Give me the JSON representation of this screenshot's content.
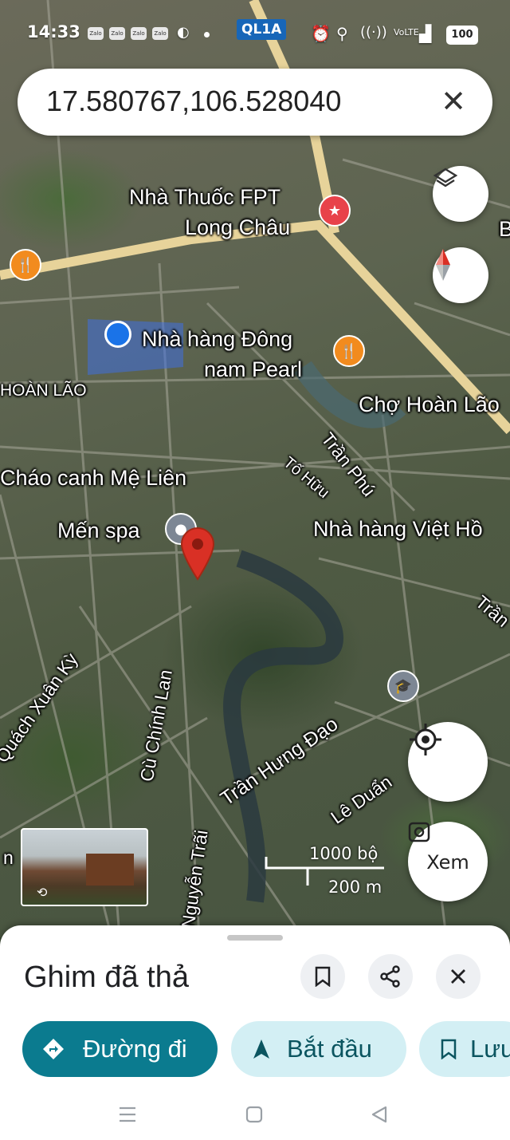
{
  "status_bar": {
    "time": "14:33",
    "app_icons": [
      "Zalo",
      "Zalo",
      "Zalo",
      "Zalo"
    ],
    "route_badge": "QL1A",
    "battery": "100"
  },
  "search": {
    "query": "17.580767,106.528040"
  },
  "map": {
    "places": {
      "pharmacy": "Nhà Thuốc FPT Long Châu",
      "pharmacy_line1": "Nhà Thuốc FPT",
      "pharmacy_line2": "Long Châu",
      "restaurant_pearl_line1": "Nhà hàng Đông",
      "restaurant_pearl_line2": "nam Pearl",
      "area": "HOÀN LÃO",
      "market": "Chợ Hoàn Lão",
      "porridge": "Cháo canh Mệ Liên",
      "spa": "Mến spa",
      "restaurant_viet": "Nhà hàng Việt Hồ",
      "edge_b": "B"
    },
    "roads": {
      "tran_phu": "Trần Phú",
      "to_huu": "Tố Hữu",
      "tran_right": "Trần",
      "quach_xuan_ky": "Quách Xuân Kỳ",
      "cu_chinh_lan": "Cù Chính Lan",
      "tran_hung_dao": "Trần Hưng Đạo",
      "le_duan": "Lê Duẩn",
      "nguyen_trai": "Nguyễn Trãi",
      "edge_n": "n"
    },
    "scale": {
      "imperial": "1000 bộ",
      "metric": "200 m"
    },
    "street_view_label": "Xem"
  },
  "sheet": {
    "title": "Ghim đã thả",
    "directions_label": "Đường đi",
    "start_label": "Bắt đầu",
    "save_label": "Lưu"
  },
  "colors": {
    "primary_button": "#0b7b8f",
    "secondary_button": "#d3eff4",
    "route_badge": "#1766b8",
    "pin": "#d93025",
    "poi_orange": "#f28b1e",
    "poi_red": "#e8424a",
    "location_dot": "#1a73e8"
  }
}
